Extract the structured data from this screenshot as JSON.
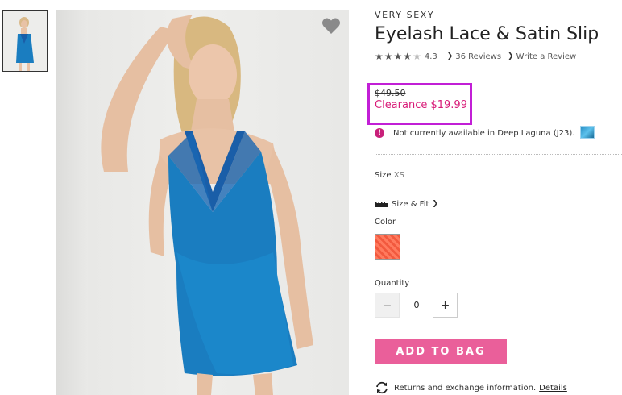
{
  "product": {
    "brand": "VERY SEXY",
    "title": "Eyelash Lace & Satin Slip",
    "rating": "4.3",
    "reviews_link": "36 Reviews",
    "write_review_link": "Write a Review",
    "old_price": "$49.50",
    "sale_price": "Clearance $19.99",
    "availability": "Not currently available in Deep Laguna (J23).",
    "size_label": "Size",
    "size_value": "XS",
    "size_fit_link": "Size & Fit",
    "color_label": "Color",
    "quantity_label": "Quantity",
    "quantity_minus": "−",
    "quantity_value": "0",
    "quantity_plus": "+",
    "add_to_bag": "ADD TO BAG",
    "returns_text": "Returns and exchange information.",
    "details_link": "Details"
  },
  "icons": {
    "wishlist": "heart-icon",
    "alert": "alert-icon",
    "size_fit": "ruler-icon",
    "returns": "refresh-icon",
    "chevron": "chevron-right-icon",
    "star": "star-icon"
  },
  "rating_stars": {
    "value": 4.3,
    "max": 5
  },
  "colors": {
    "accent_pink": "#ea5f9a",
    "sale_price": "#d81b78",
    "highlight_box": "#c21fd6",
    "alert": "#c8207a",
    "swatch_coral": "#f2593e",
    "dress_blue": "#1a7dc0"
  }
}
